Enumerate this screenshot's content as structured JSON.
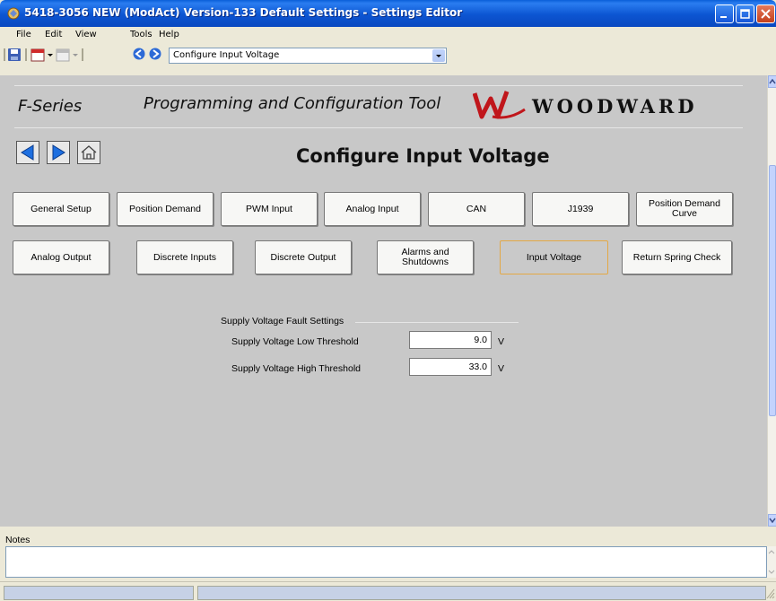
{
  "window": {
    "title": "5418-3056 NEW (ModAct) Version-133 Default Settings - Settings Editor"
  },
  "menu": {
    "items": [
      "File",
      "Edit",
      "View",
      "Tools",
      "Help"
    ]
  },
  "toolbar": {
    "nav_combo_value": "Configure Input Voltage"
  },
  "header": {
    "brand_left": "F-Series",
    "brand_title": "Programming and Configuration Tool",
    "logo_text": "WOODWARD",
    "logo_tm": "™"
  },
  "page": {
    "title": "Configure  Input Voltage"
  },
  "tabs": [
    {
      "label": "General Setup",
      "active": false
    },
    {
      "label": "Position Demand",
      "active": false
    },
    {
      "label": "PWM Input",
      "active": false
    },
    {
      "label": "Analog Input",
      "active": false
    },
    {
      "label": "CAN",
      "active": false
    },
    {
      "label": "J1939",
      "active": false
    },
    {
      "label": "Position Demand Curve",
      "active": false
    },
    {
      "label": "Analog Output",
      "active": false
    },
    {
      "label": "Discrete Inputs",
      "active": false
    },
    {
      "label": "Discrete Output",
      "active": false
    },
    {
      "label": "Alarms and Shutdowns",
      "active": false
    },
    {
      "label": "Input Voltage",
      "active": true
    },
    {
      "label": "Return Spring Check",
      "active": false
    }
  ],
  "settings": {
    "group_label": "Supply Voltage Fault Settings",
    "fields": [
      {
        "label": "Supply Voltage Low Threshold",
        "value": "9.0",
        "unit": "V"
      },
      {
        "label": "Supply Voltage High Threshold",
        "value": "33.0",
        "unit": "V"
      }
    ]
  },
  "notes": {
    "label": "Notes",
    "value": ""
  },
  "colors": {
    "titlebar": "#0c55d2",
    "content_bg": "#c8c8c8",
    "active_tab_border": "#e3a845",
    "nav_arrow": "#1e6fe0"
  }
}
